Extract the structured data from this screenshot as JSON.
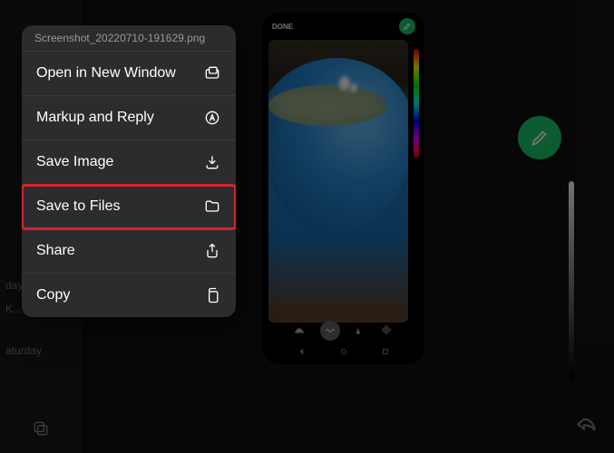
{
  "sidebar": {
    "items": [
      "",
      "day",
      "K...",
      "",
      "aturday"
    ]
  },
  "contextMenu": {
    "header": "Screenshot_20220710-191629.png",
    "items": [
      {
        "label": "Open in New Window",
        "icon": "window-icon"
      },
      {
        "label": "Markup and Reply",
        "icon": "markup-icon"
      },
      {
        "label": "Save Image",
        "icon": "download-icon"
      },
      {
        "label": "Save to Files",
        "icon": "folder-icon",
        "highlighted": true
      },
      {
        "label": "Share",
        "icon": "share-icon"
      },
      {
        "label": "Copy",
        "icon": "copy-docs-icon"
      }
    ]
  },
  "phone": {
    "doneLabel": "DONE"
  },
  "colors": {
    "accent": "#1ec96a",
    "highlight": "#d8232a"
  }
}
